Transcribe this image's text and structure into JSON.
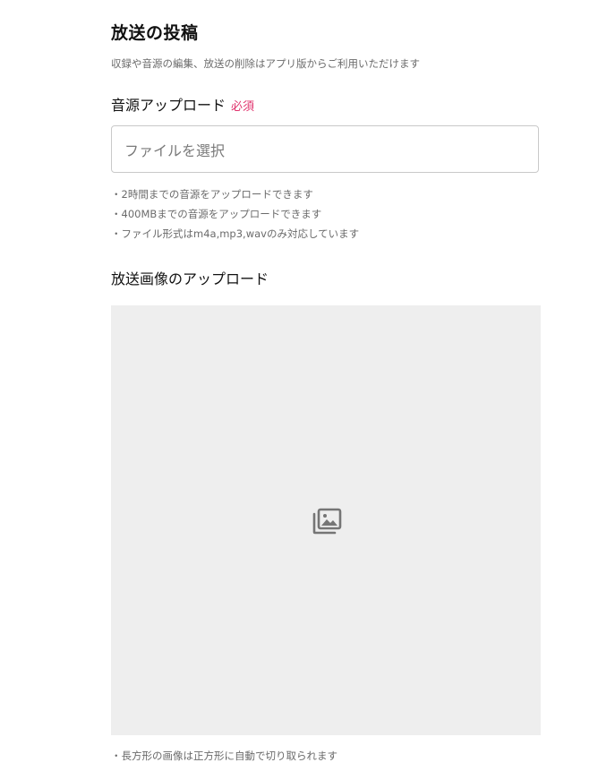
{
  "header": {
    "title": "放送の投稿",
    "subtitle": "収録や音源の編集、放送の削除はアプリ版からご利用いただけます"
  },
  "audio_upload": {
    "label": "音源アップロード",
    "required_badge": "必須",
    "placeholder": "ファイルを選択",
    "notes": [
      "・2時間までの音源をアップロードできます",
      "・400MBまでの音源をアップロードできます",
      "・ファイル形式はm4a,mp3,wavのみ対応しています"
    ]
  },
  "image_upload": {
    "label": "放送画像のアップロード",
    "icon": "image-gallery-icon",
    "notes": [
      "・長方形の画像は正方形に自動で切り取られます"
    ]
  },
  "colors": {
    "required": "#e0336d",
    "dropzone_bg": "#eeeeee",
    "icon": "#757575"
  }
}
